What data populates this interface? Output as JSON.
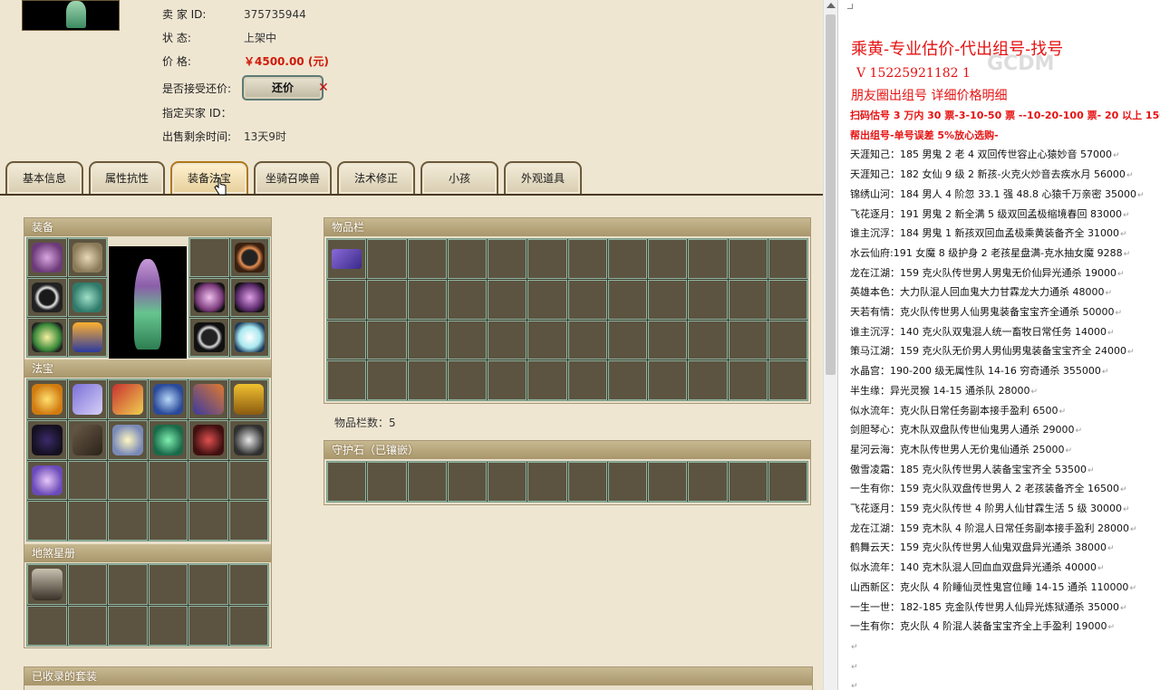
{
  "seller_info": {
    "seller_id_label": "卖 家   ID:",
    "seller_id": "375735944",
    "status_label": "状     态:",
    "status": "上架中",
    "price_label": "价     格:",
    "price": "￥4500.00 (元)",
    "accept_counter_label": "是否接受还价:",
    "counter_button": "还价",
    "buyer_id_label": "指定买家 ID：",
    "remaining_label": "出售剩余时间:",
    "remaining": "13天9时"
  },
  "tabs": [
    {
      "label": "基本信息"
    },
    {
      "label": "属性抗性"
    },
    {
      "label": "装备法宝",
      "active": true
    },
    {
      "label": "坐骑召唤兽"
    },
    {
      "label": "法术修正"
    },
    {
      "label": "小孩"
    },
    {
      "label": "外观道具"
    }
  ],
  "panels": {
    "equipment": "装备",
    "treasure": "法宝",
    "star_book": "地煞星册",
    "inventory": "物品栏",
    "inventory_count": "物品栏数：5",
    "guard_stone": "守护石（已镶嵌）",
    "collected_sets": "已收录的套装"
  },
  "colors": {
    "accent_red": "#e61212",
    "panel_header": "#b4a37a",
    "slot_bg": "#5c5440",
    "slot_border": "#8fb6a2"
  },
  "doc": {
    "title": "乘黄-专业估价-代出组号-找号",
    "phone": "V 15225921182    1",
    "friends": "朋友圈出组号     详细价格明细",
    "watermark": "GCDM",
    "lines": [
      {
        "text": "扫码估号 3 万内 30 票-3-10-50 票 --10-20-100 票- 20 以上 150",
        "red": true
      },
      {
        "text": "帮出组号-单号误差 5%放心选购-",
        "red": true
      },
      {
        "text": "天涯知己：185 男鬼 2 老 4 双回传世容止心猿妙音 57000"
      },
      {
        "text": "天涯知己：182 女仙 9 级 2 新孩-火克火炒音去疾水月 56000"
      },
      {
        "text": "锦绣山河：184 男人 4 阶忽 33.1 强 48.8 心猿千万亲密 35000"
      },
      {
        "text": "飞花逐月：191 男鬼 2 新全满 5 级双回孟极缩境春回 83000"
      },
      {
        "text": "谁主沉浮：184 男鬼 1 新孩双回血孟极乘黄装备齐全 31000"
      },
      {
        "text": "水云仙府:191 女魔 8 级护身 2 老孩星盘满-克水抽女魔 9288"
      },
      {
        "text": "龙在江湖：159 克火队传世男人男鬼无价仙异光通杀 19000"
      },
      {
        "text": "英雄本色：大力队混人回血鬼大力甘霖龙大力通杀 48000"
      },
      {
        "text": "天若有情：克火队传世男人仙男鬼装备宝宝齐全通杀 50000"
      },
      {
        "text": "谁主沉浮：140 克火队双鬼混人统一畜牧日常任务 14000"
      },
      {
        "text": "策马江湖：159 克火队无价男人男仙男鬼装备宝宝齐全 24000"
      },
      {
        "text": "水晶宫：190-200 级无属性队 14-16 穷奇通杀 355000"
      },
      {
        "text": "半生缘：异光灵猴 14-15 通杀队 28000"
      },
      {
        "text": "似水流年：克火队日常任务副本接手盈利 6500"
      },
      {
        "text": "剑胆琴心：克木队双盘队传世仙鬼男人通杀 29000"
      },
      {
        "text": "星河云海：克木队传世男人无价鬼仙通杀 25000"
      },
      {
        "text": "傲雪凌霜：185 克火队传世男人装备宝宝齐全 53500"
      },
      {
        "text": "一生有你：159 克火队双盘传世男人 2 老孩装备齐全 16500"
      },
      {
        "text": "飞花逐月：159 克火队传世 4 阶男人仙甘霖生活 5 级 30000"
      },
      {
        "text": "龙在江湖：159 克木队 4 阶混人日常任务副本接手盈利 28000"
      },
      {
        "text": "鹤舞云天：159 克火队传世男人仙鬼双盘异光通杀 38000"
      },
      {
        "text": "似水流年：140 克木队混人回血血双盘异光通杀 40000"
      },
      {
        "text": "山西新区：克火队 4 阶睡仙灵性鬼宫位睡 14-15 通杀 110000"
      },
      {
        "text": "一生一世：182-185 克金队传世男人仙异光炼狱通杀 35000"
      },
      {
        "text": "一生有你：克火队 4 阶混人装备宝宝齐全上手盈利 19000"
      }
    ],
    "para_mark": "↵"
  }
}
